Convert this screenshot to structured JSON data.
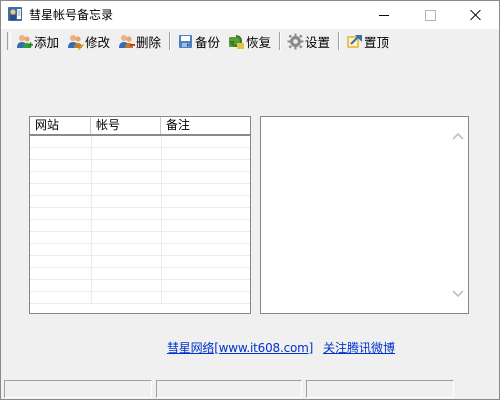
{
  "window": {
    "title": "彗星帐号备忘录"
  },
  "toolbar": {
    "items": [
      {
        "label": "添加",
        "icon": "add-user-icon"
      },
      {
        "label": "修改",
        "icon": "edit-user-icon"
      },
      {
        "label": "删除",
        "icon": "delete-user-icon"
      },
      {
        "label": "备份",
        "icon": "backup-icon"
      },
      {
        "label": "恢复",
        "icon": "restore-icon"
      },
      {
        "label": "设置",
        "icon": "gear-icon"
      },
      {
        "label": "置顶",
        "icon": "pin-top-icon"
      }
    ]
  },
  "table": {
    "columns": [
      "网站",
      "帐号",
      "备注"
    ],
    "rows": []
  },
  "notes": {
    "value": ""
  },
  "links": {
    "site": "彗星网络[www.it608.com]",
    "weibo": "关注腾讯微博"
  },
  "statusbar": {
    "panes": [
      "",
      "",
      ""
    ]
  },
  "colors": {
    "link": "#0033cc",
    "window_bg": "#f0f0f0"
  }
}
